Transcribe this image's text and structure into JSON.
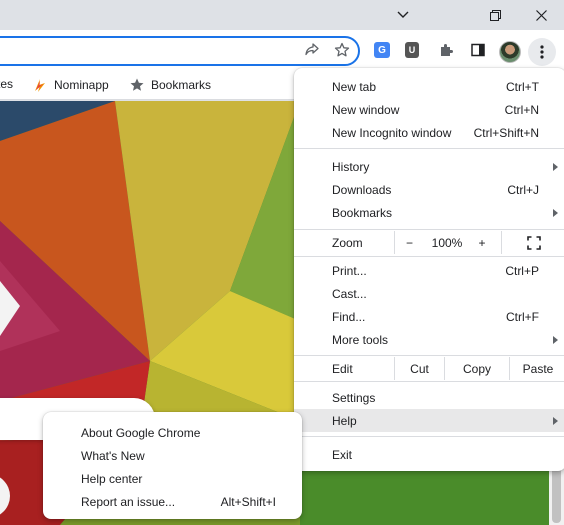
{
  "bookmarks": {
    "items": [
      {
        "label": "tes"
      },
      {
        "label": "Nominapp"
      },
      {
        "label": "Bookmarks"
      }
    ]
  },
  "toolbar": {
    "icons": [
      "share-icon",
      "star-icon",
      "google-translate-extension-icon",
      "bitwarden-extension-icon",
      "extensions-puzzle-icon",
      "side-panel-icon",
      "profile-avatar",
      "kebab-menu-icon"
    ]
  },
  "menu": {
    "new_tab": {
      "label": "New tab",
      "shortcut": "Ctrl+T"
    },
    "new_window": {
      "label": "New window",
      "shortcut": "Ctrl+N"
    },
    "new_incognito": {
      "label": "New Incognito window",
      "shortcut": "Ctrl+Shift+N"
    },
    "history": {
      "label": "History"
    },
    "downloads": {
      "label": "Downloads",
      "shortcut": "Ctrl+J"
    },
    "bookmarks": {
      "label": "Bookmarks"
    },
    "zoom": {
      "label": "Zoom",
      "minus": "−",
      "value": "100%",
      "plus": "+"
    },
    "print": {
      "label": "Print...",
      "shortcut": "Ctrl+P"
    },
    "cast": {
      "label": "Cast..."
    },
    "find": {
      "label": "Find...",
      "shortcut": "Ctrl+F"
    },
    "more_tools": {
      "label": "More tools"
    },
    "edit": {
      "label": "Edit",
      "cut": "Cut",
      "copy": "Copy",
      "paste": "Paste"
    },
    "settings": {
      "label": "Settings"
    },
    "help": {
      "label": "Help"
    },
    "exit": {
      "label": "Exit"
    }
  },
  "help_submenu": {
    "about": {
      "label": "About Google Chrome"
    },
    "whats_new": {
      "label": "What's New"
    },
    "help_center": {
      "label": "Help center"
    },
    "report_issue": {
      "label": "Report an issue...",
      "shortcut": "Alt+Shift+I"
    }
  },
  "colors": {
    "accent": "#1a73e8",
    "highlight": "#e8e8e9"
  }
}
